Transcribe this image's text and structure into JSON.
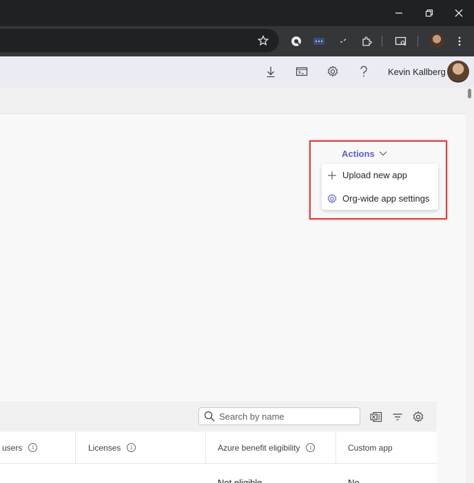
{
  "browser": {
    "window_controls": {
      "minimize": "–",
      "restore": "⧉",
      "close": "✕"
    },
    "toolbar_icons": [
      "star-icon",
      "extension-icon",
      "password-icon",
      "tab-search-icon",
      "puzzle-icon",
      "cast-icon",
      "menu-icon"
    ]
  },
  "appbar": {
    "user_name": "Kevin Kallberg"
  },
  "actions": {
    "label": "Actions",
    "menu": [
      {
        "icon": "plus-icon",
        "label": "Upload new app"
      },
      {
        "icon": "gear-icon",
        "label": "Org-wide app settings"
      }
    ]
  },
  "table": {
    "search_placeholder": "Search by name",
    "columns": [
      {
        "label": "users",
        "info": true
      },
      {
        "label": "Licenses",
        "info": true
      },
      {
        "label": "Azure benefit eligibility",
        "info": true
      },
      {
        "label": "Custom app",
        "info": false
      }
    ],
    "rows": [
      {
        "azure": "Not eligible",
        "custom": "No"
      }
    ]
  },
  "colors": {
    "accent": "#5b5fc7",
    "highlight_border": "#e23b3b"
  }
}
